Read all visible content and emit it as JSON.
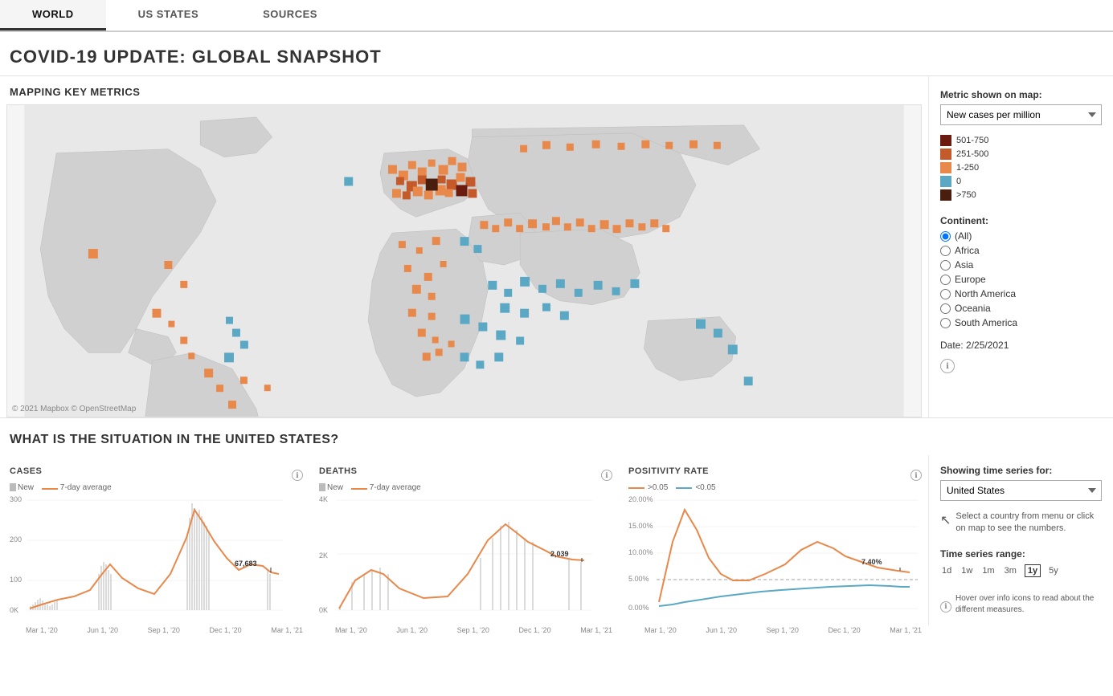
{
  "tabs": [
    {
      "label": "WORLD",
      "active": true
    },
    {
      "label": "US STATES",
      "active": false
    },
    {
      "label": "SOURCES",
      "active": false
    }
  ],
  "page_title": "COVID-19 UPDATE: GLOBAL SNAPSHOT",
  "map_section": {
    "title": "MAPPING KEY METRICS",
    "copyright": "© 2021 Mapbox © OpenStreetMap",
    "metric_label": "Metric shown on map:",
    "metric_value": "New cases per million",
    "legend": [
      {
        "color": "#6b1c0e",
        "label": "501-750"
      },
      {
        "color": "#c45a2a",
        "label": "251-500"
      },
      {
        "color": "#e8884a",
        "label": "1-250"
      },
      {
        "color": "#5ba8c4",
        "label": "0"
      },
      {
        "color": "#4a1e0e",
        "label": ">750"
      }
    ],
    "continent_label": "Continent:",
    "continents": [
      "(All)",
      "Africa",
      "Asia",
      "Europe",
      "North America",
      "Oceania",
      "South America"
    ],
    "selected_continent": "(All)",
    "date_label": "Date: 2/25/2021"
  },
  "situation_section": {
    "title": "WHAT IS THE SITUATION IN THE UNITED STATES?",
    "cases_chart": {
      "title": "CASES",
      "legend_bar": "New",
      "legend_line": "7-day average",
      "y_labels": [
        "300",
        "200",
        "100",
        "0K"
      ],
      "annotation": "67,683",
      "x_labels": [
        "Mar 1, '20",
        "Jun 1, '20",
        "Sep 1, '20",
        "Dec 1, '20",
        "Mar 1, '21"
      ]
    },
    "deaths_chart": {
      "title": "DEATHS",
      "legend_bar": "New",
      "legend_line": "7-day average",
      "y_labels": [
        "4K",
        "2K",
        "0K"
      ],
      "annotation": "2,039",
      "x_labels": [
        "Mar 1, '20",
        "Jun 1, '20",
        "Sep 1, '20",
        "Dec 1, '20",
        "Mar 1, '21"
      ]
    },
    "positivity_chart": {
      "title": "POSITIVITY RATE",
      "legend_high": ">0.05",
      "legend_low": "<0.05",
      "y_labels": [
        "20.00%",
        "15.00%",
        "10.00%",
        "5.00%",
        "0.00%"
      ],
      "annotation": "7.40%",
      "x_labels": [
        "Mar 1, '20",
        "Jun 1, '20",
        "Sep 1, '20",
        "Dec 1, '20",
        "Mar 1, '21"
      ]
    },
    "showing_label": "Showing time series for:",
    "country_value": "United States",
    "select_hint": "Select a country from menu or click on map to see the numbers.",
    "time_range_label": "Time series range:",
    "time_ranges": [
      "1d",
      "1w",
      "1m",
      "3m",
      "1y",
      "5y"
    ],
    "active_range": "1y",
    "hover_hint": "Hover over info icons to read about the different measures."
  }
}
